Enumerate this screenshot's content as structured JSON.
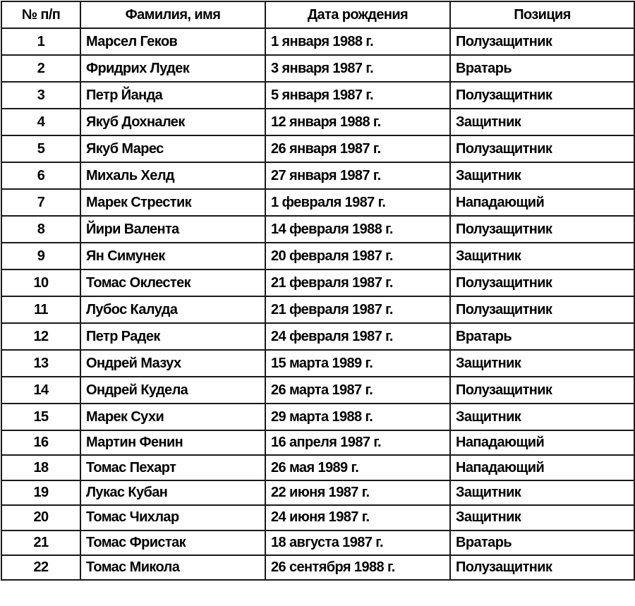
{
  "table": {
    "headers": [
      "№ п/п",
      "Фамилия, имя",
      "Дата рождения",
      "Позиция"
    ],
    "rows": [
      {
        "num": "1",
        "name": "Марсел Геков",
        "dob": "1 января 1988 г.",
        "position": "Полузащитник"
      },
      {
        "num": "2",
        "name": "Фридрих Лудек",
        "dob": "3 января 1987 г.",
        "position": "Вратарь"
      },
      {
        "num": "3",
        "name": "Петр Йанда",
        "dob": "5 января 1987 г.",
        "position": "Полузащитник"
      },
      {
        "num": "4",
        "name": "Якуб Дохналек",
        "dob": "12 января 1988 г.",
        "position": "Защитник"
      },
      {
        "num": "5",
        "name": "Якуб Марес",
        "dob": "26 января 1987 г.",
        "position": "Полузащитник"
      },
      {
        "num": "6",
        "name": "Михаль Хелд",
        "dob": "27 января 1987 г.",
        "position": "Защитник"
      },
      {
        "num": "7",
        "name": "Марек Стрестик",
        "dob": "1 февраля 1987 г.",
        "position": "Нападающий"
      },
      {
        "num": "8",
        "name": "Йири Валента",
        "dob": "14 февраля 1988 г.",
        "position": "Полузащитник"
      },
      {
        "num": "9",
        "name": "Ян Симунек",
        "dob": "20 февраля 1987 г.",
        "position": "Защитник"
      },
      {
        "num": "10",
        "name": "Томас Оклестек",
        "dob": "21 февраля 1987 г.",
        "position": "Полузащитник"
      },
      {
        "num": "11",
        "name": "Лубос Калуда",
        "dob": "21 февраля 1987 г.",
        "position": "Полузащитник"
      },
      {
        "num": "12",
        "name": "Петр Радек",
        "dob": "24 февраля 1987 г.",
        "position": "Вратарь"
      },
      {
        "num": "13",
        "name": "Ондрей Мазух",
        "dob": "15 марта 1989 г.",
        "position": "Защитник"
      },
      {
        "num": "14",
        "name": "Ондрей Кудела",
        "dob": "26 марта 1987 г.",
        "position": "Полузащитник"
      },
      {
        "num": "15",
        "name": "Марек Сухи",
        "dob": "29 марта 1988 г.",
        "position": "Защитник"
      },
      {
        "num": "16",
        "name": "Мартин Фенин",
        "dob": "16 апреля 1987 г.",
        "position": "Нападающий"
      },
      {
        "num": "18",
        "name": "Томас Пехарт",
        "dob": "26 мая 1989 г.",
        "position": "Нападающий"
      },
      {
        "num": "19",
        "name": "Лукас Кубан",
        "dob": "22 июня 1987 г.",
        "position": "Защитник"
      },
      {
        "num": "20",
        "name": "Томас Чихлар",
        "dob": "24 июня 1987 г.",
        "position": "Защитник"
      },
      {
        "num": "21",
        "name": "Томас Фристак",
        "dob": "18 августа 1987 г.",
        "position": "Вратарь"
      },
      {
        "num": "22",
        "name": "Томас Микола",
        "dob": "26 сентября 1988 г.",
        "position": "Полузащитник"
      }
    ]
  }
}
